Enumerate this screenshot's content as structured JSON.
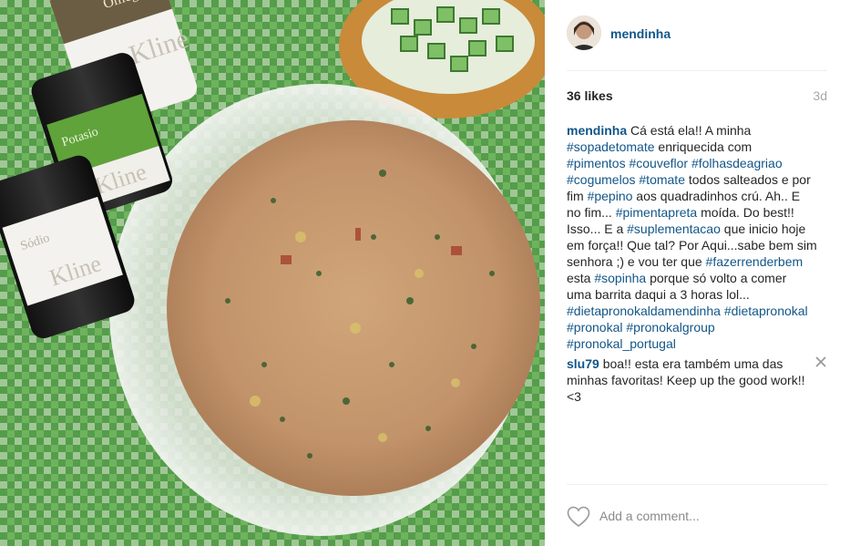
{
  "post": {
    "username": "mendinha",
    "likes": "36 likes",
    "age": "3d"
  },
  "caption": {
    "author": "mendinha",
    "lines": [
      [
        {
          "t": "text",
          "v": " Cá está ela!! A minha"
        }
      ],
      [
        {
          "t": "tag",
          "v": "#sopadetomate"
        },
        {
          "t": "text",
          "v": " enriquecida com"
        }
      ],
      [
        {
          "t": "tag",
          "v": "#pimentos"
        },
        {
          "t": "text",
          "v": " "
        },
        {
          "t": "tag",
          "v": "#couveflor"
        },
        {
          "t": "text",
          "v": " "
        },
        {
          "t": "tag",
          "v": "#folhasdeagriao"
        }
      ],
      [
        {
          "t": "tag",
          "v": "#cogumelos"
        },
        {
          "t": "text",
          "v": " "
        },
        {
          "t": "tag",
          "v": "#tomate"
        },
        {
          "t": "text",
          "v": " todos salteados e por"
        }
      ],
      [
        {
          "t": "text",
          "v": "fim "
        },
        {
          "t": "tag",
          "v": "#pepino"
        },
        {
          "t": "text",
          "v": " aos quadradinhos crú. Ah.. E"
        }
      ],
      [
        {
          "t": "text",
          "v": "no fim... "
        },
        {
          "t": "tag",
          "v": "#pimentapreta"
        },
        {
          "t": "text",
          "v": " moída. Do best!!"
        }
      ],
      [
        {
          "t": "text",
          "v": "Isso... E a "
        },
        {
          "t": "tag",
          "v": "#suplementacao"
        },
        {
          "t": "text",
          "v": " que inicio hoje"
        }
      ],
      [
        {
          "t": "text",
          "v": "em força!! Que tal? Por Aqui...sabe bem sim"
        }
      ],
      [
        {
          "t": "text",
          "v": "senhora ;) e vou ter que "
        },
        {
          "t": "tag",
          "v": "#fazerrenderbem"
        }
      ],
      [
        {
          "t": "text",
          "v": "esta "
        },
        {
          "t": "tag",
          "v": "#sopinha"
        },
        {
          "t": "text",
          "v": " porque só volto a comer"
        }
      ],
      [
        {
          "t": "text",
          "v": "uma barrita daqui a 3 horas lol..."
        }
      ],
      [
        {
          "t": "tag",
          "v": "#dietapronokaldamendinha"
        },
        {
          "t": "text",
          "v": " "
        },
        {
          "t": "tag",
          "v": "#dietapronokal"
        }
      ],
      [
        {
          "t": "tag",
          "v": "#pronokal"
        },
        {
          "t": "text",
          "v": " "
        },
        {
          "t": "tag",
          "v": "#pronokalgroup"
        }
      ],
      [
        {
          "t": "tag",
          "v": "#pronokal_portugal"
        }
      ]
    ]
  },
  "comment": {
    "author": "slu79",
    "lines": [
      [
        {
          "t": "text",
          "v": " boa!! esta era também uma das"
        }
      ],
      [
        {
          "t": "text",
          "v": "minhas favoritas! Keep up the good work!!"
        }
      ],
      [
        {
          "t": "text",
          "v": "<3"
        }
      ]
    ]
  },
  "footer": {
    "add_comment_placeholder": "Add a comment..."
  },
  "photo": {
    "jar_labels": [
      "Omega",
      "Potasio",
      "Sódio"
    ],
    "brand": "Kline"
  },
  "colors": {
    "link": "#125688",
    "text": "#262626",
    "muted": "#a5a7aa",
    "tablecloth": "#4f9a45",
    "soup": "#c99a6e"
  },
  "icons": {
    "like": "heart-outline-icon",
    "remove": "close-icon"
  }
}
